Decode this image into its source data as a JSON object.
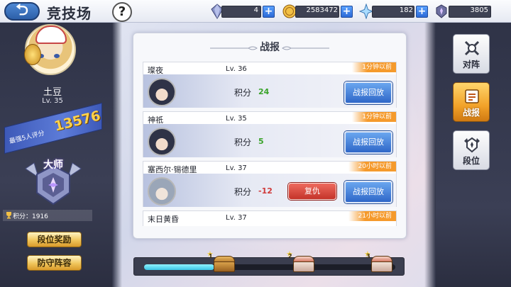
{
  "header": {
    "back_label": "⮌",
    "title": "竞技场",
    "help_label": "?",
    "resources": [
      {
        "icon": "crystal-icon",
        "value": "4"
      },
      {
        "icon": "gold-coin-icon",
        "value": "2583472"
      },
      {
        "icon": "star-shard-icon",
        "value": "182"
      },
      {
        "icon": "medal-icon",
        "value": "3805"
      }
    ]
  },
  "player": {
    "name": "土豆",
    "level": "Lv. 35",
    "top5_label": "最强5人评分",
    "top5_score": "13576",
    "rank_title": "大师",
    "points": "积分：1916",
    "reward_button": "段位奖励",
    "defense_button": "防守阵容"
  },
  "battle_report": {
    "title": "战报",
    "score_label": "积分",
    "replay_label": "战报回放",
    "revenge_label": "复仇",
    "entries": [
      {
        "name": "璨夜",
        "level": "Lv. 36",
        "time": "1分钟以前",
        "score": "24",
        "sign": "pos",
        "revenge": false
      },
      {
        "name": "神祇",
        "level": "Lv. 35",
        "time": "1分钟以前",
        "score": "5",
        "sign": "pos",
        "revenge": false
      },
      {
        "name": "塞西尔·锡德里",
        "level": "Lv. 37",
        "time": "20小时以前",
        "score": "-12",
        "sign": "neg",
        "revenge": true
      },
      {
        "name": "末日黄昏",
        "level": "Lv. 37",
        "time": "21小时以前",
        "score": "",
        "sign": "pos",
        "revenge": false
      }
    ]
  },
  "progress": {
    "fill_fraction": 0.28,
    "chests": [
      {
        "stars": "1",
        "type": "wood"
      },
      {
        "stars": "2",
        "type": "red"
      },
      {
        "stars": "3",
        "type": "red"
      }
    ]
  },
  "tabs": [
    {
      "label": "对阵",
      "icon": "crossed-swords-icon",
      "active": false
    },
    {
      "label": "战报",
      "icon": "scroll-icon",
      "active": true
    },
    {
      "label": "段位",
      "icon": "rank-crest-icon",
      "active": false
    }
  ],
  "colors": {
    "accent_blue": "#2f67c8",
    "positive": "#3aa32a",
    "negative": "#d03a3a",
    "gold": "#ffd24a",
    "tab_active": "#f2a229",
    "progress": "#3cc6e6"
  }
}
